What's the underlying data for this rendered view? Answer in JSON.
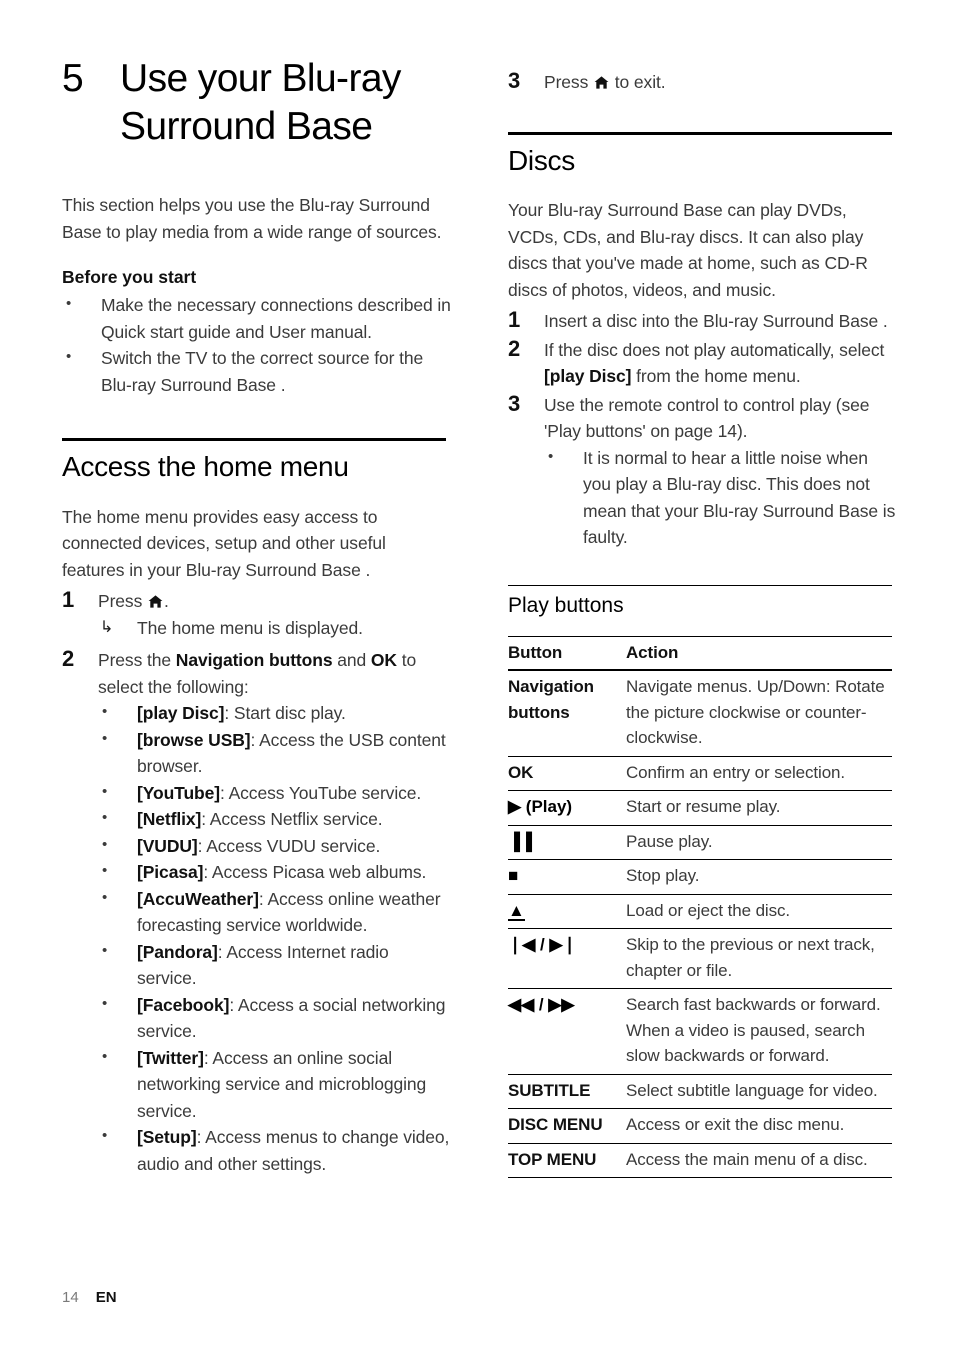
{
  "document": {
    "chapter_number": "5",
    "chapter_title": "Use your Blu-ray Surround Base",
    "footer": {
      "page_number": "14",
      "language": "EN"
    }
  },
  "left_column": {
    "intro": "This section helps you use the Blu-ray Surround Base  to play media from a wide range of sources.",
    "before_you_start": {
      "heading": "Before you start",
      "items": [
        "Make the necessary connections described in Quick start guide and User manual.",
        "Switch the TV to the correct source for the Blu-ray Surround Base ."
      ]
    },
    "access_home_menu": {
      "heading": "Access the home menu",
      "intro": "The home menu provides easy access to connected devices, setup and other useful features in your Blu-ray Surround Base .",
      "step1": {
        "num": "1",
        "text_before_icon": "Press ",
        "icon": "home-icon",
        "text_after_icon": ".",
        "result": "The home menu is displayed."
      },
      "step2": {
        "num": "2",
        "lead_1": "Press the ",
        "lead_bold_1": "Navigation buttons",
        "lead_2": " and ",
        "lead_bold_2": "OK",
        "lead_3": " to select the following:",
        "options": [
          {
            "label": "[play Disc]",
            "desc": ": Start disc play."
          },
          {
            "label": "[browse USB]",
            "desc": ": Access the USB content browser."
          },
          {
            "label": "[YouTube]",
            "desc": ": Access YouTube service."
          },
          {
            "label": "[Netflix]",
            "desc": ": Access Netflix service."
          },
          {
            "label": "[VUDU]",
            "desc": ": Access VUDU service."
          },
          {
            "label": "[Picasa]",
            "desc": ": Access Picasa web albums."
          },
          {
            "label": "[AccuWeather]",
            "desc": ": Access online weather forecasting service worldwide."
          },
          {
            "label": "[Pandora]",
            "desc": ": Access Internet radio service."
          },
          {
            "label": "[Facebook]",
            "desc": ": Access a social networking service."
          },
          {
            "label": "[Twitter]",
            "desc": ": Access an online social networking service and microblogging service."
          },
          {
            "label": "[Setup]",
            "desc": ": Access menus to change video, audio and other settings."
          }
        ]
      }
    }
  },
  "right_column": {
    "step3": {
      "num": "3",
      "text_before_icon": "Press ",
      "icon": "home-icon",
      "text_after_icon": " to exit."
    },
    "discs": {
      "heading": "Discs",
      "intro": "Your Blu-ray Surround Base  can play DVDs, VCDs, CDs, and Blu-ray discs. It can also play discs that you've made at home, such as CD-R discs of photos, videos, and music.",
      "steps": [
        {
          "num": "1",
          "text": "Insert a disc into the Blu-ray Surround Base ."
        },
        {
          "num": "2",
          "pre": "If the disc does not play automatically, select ",
          "bold": "[play Disc]",
          "post": " from the home menu."
        },
        {
          "num": "3",
          "text": "Use the remote control to control play (see 'Play buttons' on page 14).",
          "note": "It is normal to hear a little noise when you play a Blu-ray disc. This does not mean that your Blu-ray Surround Base is faulty."
        }
      ]
    },
    "play_buttons": {
      "heading": "Play buttons",
      "columns": [
        "Button",
        "Action"
      ],
      "rows": [
        {
          "button": "Navigation buttons",
          "type": "text",
          "action": "Navigate menus. Up/Down: Rotate the picture clockwise or counter-clockwise."
        },
        {
          "button": "OK",
          "type": "text",
          "action": "Confirm an entry or selection."
        },
        {
          "button": "▶ (Play)",
          "type": "symbol",
          "icon": "play-icon",
          "action": "Start or resume play."
        },
        {
          "button": "▐▐",
          "type": "symbol",
          "icon": "pause-icon",
          "action": "Pause play."
        },
        {
          "button": "■",
          "type": "symbol",
          "icon": "stop-icon",
          "action": "Stop play."
        },
        {
          "button": "▲",
          "type": "symbol",
          "icon": "eject-icon",
          "action": "Load or eject the disc."
        },
        {
          "button": "❘◀ / ▶❘",
          "type": "symbol",
          "icon": "skip-icon",
          "action": "Skip to the previous or next track, chapter or file."
        },
        {
          "button": "◀◀ / ▶▶",
          "type": "symbol",
          "icon": "search-icon",
          "action": "Search fast backwards or forward. When a video is paused, search slow backwards or forward."
        },
        {
          "button": "SUBTITLE",
          "type": "text",
          "action": "Select subtitle language for video."
        },
        {
          "button": "DISC MENU",
          "type": "text",
          "action": "Access or exit the disc menu."
        },
        {
          "button": "TOP MENU",
          "type": "text",
          "action": "Access the main menu of a disc."
        }
      ]
    }
  }
}
